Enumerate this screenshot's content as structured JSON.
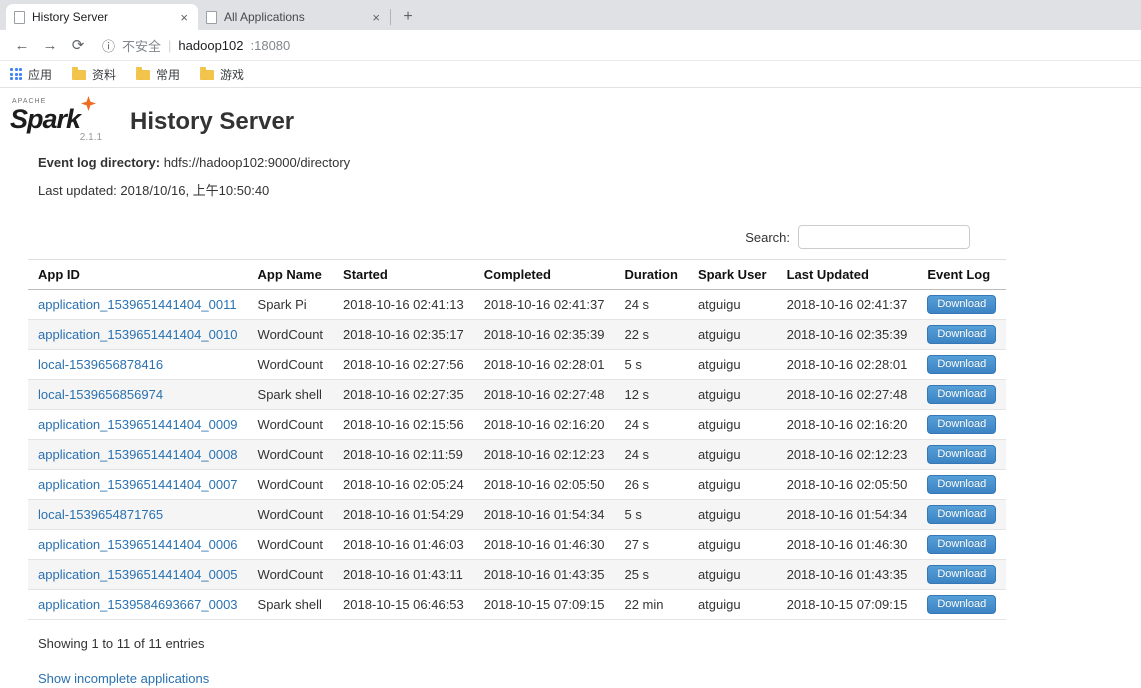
{
  "colors": {
    "link": "#2a71b0",
    "btn_top": "#55a0d8",
    "btn_bottom": "#3d83c4",
    "btn_border": "#3578b5"
  },
  "browser": {
    "tabs": [
      {
        "title": "History Server"
      },
      {
        "title": "All Applications"
      }
    ],
    "icons": {
      "back": "←",
      "forward": "→",
      "refresh": "⟳",
      "info": "ⓘ",
      "close": "×",
      "new_tab": "+"
    },
    "address": {
      "security_text": "不安全",
      "separator": "|",
      "host": "hadoop102",
      "port": ":18080"
    },
    "bookmarks": [
      {
        "label": "应用",
        "icon": "apps-grid-icon"
      },
      {
        "label": "资料",
        "icon": "folder-icon"
      },
      {
        "label": "常用",
        "icon": "folder-icon"
      },
      {
        "label": "游戏",
        "icon": "folder-icon"
      }
    ]
  },
  "page": {
    "brand": {
      "apache": "APACHE",
      "name": "Spark",
      "version": "2.1.1"
    },
    "title": "History Server",
    "event_log_label": "Event log directory:",
    "event_log_value": "hdfs://hadoop102:9000/directory",
    "last_updated": "Last updated: 2018/10/16, 上午10:50:40",
    "search_label": "Search:",
    "table": {
      "headers": [
        "App ID",
        "App Name",
        "Started",
        "Completed",
        "Duration",
        "Spark User",
        "Last Updated",
        "Event Log"
      ],
      "rows": [
        {
          "app_id": "application_1539651441404_0011",
          "app_name": "Spark Pi",
          "started": "2018-10-16 02:41:13",
          "completed": "2018-10-16 02:41:37",
          "duration": "24 s",
          "spark_user": "atguigu",
          "last_updated": "2018-10-16 02:41:37",
          "event_log": "Download"
        },
        {
          "app_id": "application_1539651441404_0010",
          "app_name": "WordCount",
          "started": "2018-10-16 02:35:17",
          "completed": "2018-10-16 02:35:39",
          "duration": "22 s",
          "spark_user": "atguigu",
          "last_updated": "2018-10-16 02:35:39",
          "event_log": "Download"
        },
        {
          "app_id": "local-1539656878416",
          "app_name": "WordCount",
          "started": "2018-10-16 02:27:56",
          "completed": "2018-10-16 02:28:01",
          "duration": "5 s",
          "spark_user": "atguigu",
          "last_updated": "2018-10-16 02:28:01",
          "event_log": "Download"
        },
        {
          "app_id": "local-1539656856974",
          "app_name": "Spark shell",
          "started": "2018-10-16 02:27:35",
          "completed": "2018-10-16 02:27:48",
          "duration": "12 s",
          "spark_user": "atguigu",
          "last_updated": "2018-10-16 02:27:48",
          "event_log": "Download"
        },
        {
          "app_id": "application_1539651441404_0009",
          "app_name": "WordCount",
          "started": "2018-10-16 02:15:56",
          "completed": "2018-10-16 02:16:20",
          "duration": "24 s",
          "spark_user": "atguigu",
          "last_updated": "2018-10-16 02:16:20",
          "event_log": "Download"
        },
        {
          "app_id": "application_1539651441404_0008",
          "app_name": "WordCount",
          "started": "2018-10-16 02:11:59",
          "completed": "2018-10-16 02:12:23",
          "duration": "24 s",
          "spark_user": "atguigu",
          "last_updated": "2018-10-16 02:12:23",
          "event_log": "Download"
        },
        {
          "app_id": "application_1539651441404_0007",
          "app_name": "WordCount",
          "started": "2018-10-16 02:05:24",
          "completed": "2018-10-16 02:05:50",
          "duration": "26 s",
          "spark_user": "atguigu",
          "last_updated": "2018-10-16 02:05:50",
          "event_log": "Download"
        },
        {
          "app_id": "local-1539654871765",
          "app_name": "WordCount",
          "started": "2018-10-16 01:54:29",
          "completed": "2018-10-16 01:54:34",
          "duration": "5 s",
          "spark_user": "atguigu",
          "last_updated": "2018-10-16 01:54:34",
          "event_log": "Download"
        },
        {
          "app_id": "application_1539651441404_0006",
          "app_name": "WordCount",
          "started": "2018-10-16 01:46:03",
          "completed": "2018-10-16 01:46:30",
          "duration": "27 s",
          "spark_user": "atguigu",
          "last_updated": "2018-10-16 01:46:30",
          "event_log": "Download"
        },
        {
          "app_id": "application_1539651441404_0005",
          "app_name": "WordCount",
          "started": "2018-10-16 01:43:11",
          "completed": "2018-10-16 01:43:35",
          "duration": "25 s",
          "spark_user": "atguigu",
          "last_updated": "2018-10-16 01:43:35",
          "event_log": "Download"
        },
        {
          "app_id": "application_1539584693667_0003",
          "app_name": "Spark shell",
          "started": "2018-10-15 06:46:53",
          "completed": "2018-10-15 07:09:15",
          "duration": "22 min",
          "spark_user": "atguigu",
          "last_updated": "2018-10-15 07:09:15",
          "event_log": "Download"
        }
      ]
    },
    "footer": {
      "showing": "Showing 1 to 11 of 11 entries",
      "incomplete_link": "Show incomplete applications"
    }
  }
}
